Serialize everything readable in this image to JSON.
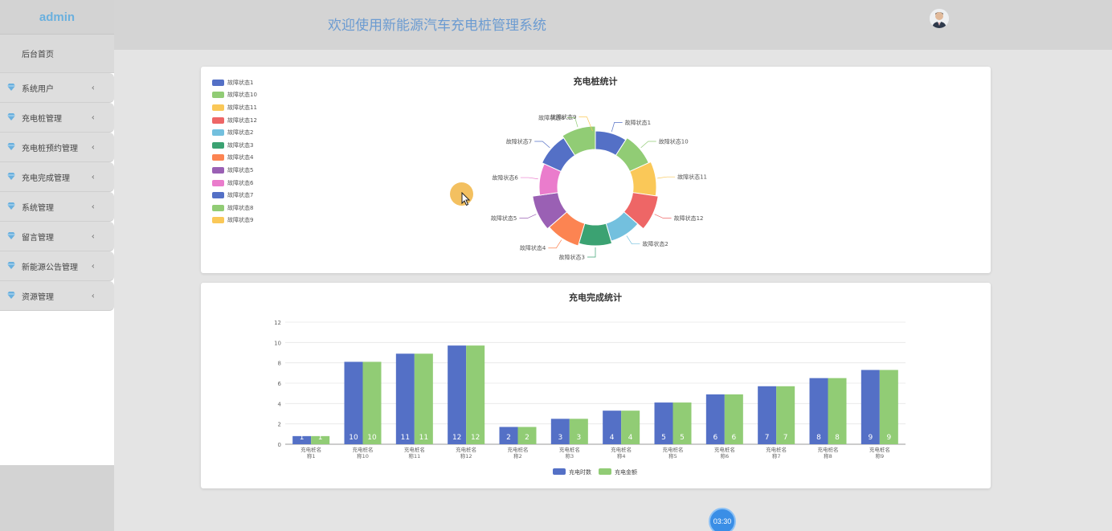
{
  "sidebar": {
    "brand": "admin",
    "home": "后台首页",
    "items": [
      {
        "label": "系统用户"
      },
      {
        "label": "充电桩管理"
      },
      {
        "label": "充电桩预约管理"
      },
      {
        "label": "充电完成管理"
      },
      {
        "label": "系统管理"
      },
      {
        "label": "留言管理"
      },
      {
        "label": "新能源公告管理"
      },
      {
        "label": "资源管理"
      }
    ]
  },
  "header": {
    "title": "欢迎使用新能源汽车充电桩管理系统"
  },
  "timer": "03:30",
  "colors": {
    "palette": [
      "#5470c6",
      "#91cc75",
      "#fac858",
      "#ee6666",
      "#73c0de",
      "#3ba272",
      "#fc8452",
      "#9a60b4",
      "#ea7ccc"
    ],
    "accent": "#6b9bd1"
  },
  "chart_data": [
    {
      "type": "pie",
      "title": "充电桩统计",
      "legend_position": "top-left",
      "categories": [
        "故障状态1",
        "故障状态10",
        "故障状态11",
        "故障状态12",
        "故障状态2",
        "故障状态3",
        "故障状态4",
        "故障状态5",
        "故障状态6",
        "故障状态7",
        "故障状态8",
        "故障状态9"
      ],
      "values": [
        1,
        1,
        1,
        1,
        1,
        1,
        1,
        1,
        1,
        1,
        1,
        0
      ]
    },
    {
      "type": "bar",
      "title": "充电完成统计",
      "legend_position": "bottom",
      "categories": [
        "充电桩名称1",
        "充电桩名称10",
        "充电桩名称11",
        "充电桩名称12",
        "充电桩名称2",
        "充电桩名称3",
        "充电桩名称4",
        "充电桩名称5",
        "充电桩名称6",
        "充电桩名称7",
        "充电桩名称8",
        "充电桩名称9"
      ],
      "ylim": [
        0,
        12
      ],
      "yticks": [
        0,
        2,
        4,
        6,
        8,
        10,
        12
      ],
      "grid": true,
      "series": [
        {
          "name": "充电时数",
          "values": [
            0.8,
            8.1,
            8.9,
            9.7,
            1.7,
            2.5,
            3.3,
            4.1,
            4.9,
            5.7,
            6.5,
            7.3
          ],
          "labels": [
            "1",
            "10",
            "11",
            "12",
            "2",
            "3",
            "4",
            "5",
            "6",
            "7",
            "8",
            "9"
          ]
        },
        {
          "name": "充电金额",
          "values": [
            0.8,
            8.1,
            8.9,
            9.7,
            1.7,
            2.5,
            3.3,
            4.1,
            4.9,
            5.7,
            6.5,
            7.3
          ],
          "labels": [
            "1",
            "10",
            "11",
            "12",
            "2",
            "3",
            "4",
            "5",
            "6",
            "7",
            "8",
            "9"
          ]
        }
      ]
    }
  ]
}
